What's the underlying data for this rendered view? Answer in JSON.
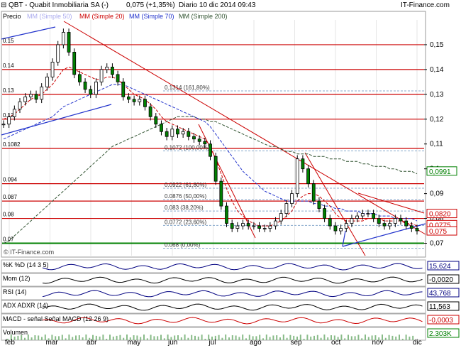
{
  "header": {
    "symbol_line": "QBT - Quabit Inmobiliaria SA (-)",
    "price_change": "0,075 (+1,35%)",
    "period_date": "Diario  10 dic 2014 09:43",
    "brand": "IT-Finance.com"
  },
  "legend": {
    "price": "Precio",
    "mm50": "MM (Simple 50)",
    "mm20": "MM (Simple 20)",
    "mm70": "MM (Simple 70)",
    "mm200": "MM (Simple 200)"
  },
  "watermark": "© IT-Finance.com",
  "colors": {
    "price": "#008000",
    "mm20": "#cc0000",
    "mm50": "#aaaaee",
    "mm70": "#2233cc",
    "mm200": "#335533",
    "resistance": "#cc0000",
    "support": "#008000",
    "trend_blue": "#2233cc",
    "fib": "#88aacc"
  },
  "chart_data": [
    {
      "type": "candlestick",
      "title": "",
      "months": [
        "feb",
        "mar",
        "abr",
        "may",
        "jun",
        "jul",
        "ago",
        "sep",
        "oct",
        "nov",
        "dic"
      ],
      "ylim": [
        0.065,
        0.16
      ],
      "y_ticks": [
        "0,15",
        "0,14",
        "0,13",
        "0,12",
        "0,11",
        "0,1",
        "0,09",
        "0,08",
        "0,07"
      ],
      "y_tick_values": [
        0.15,
        0.14,
        0.13,
        0.12,
        0.11,
        0.1,
        0.09,
        0.08,
        0.07
      ],
      "left_labels": [
        {
          "text": "0.15",
          "value": 0.15
        },
        {
          "text": "0.14",
          "value": 0.14
        },
        {
          "text": "0.13",
          "value": 0.13
        },
        {
          "text": "0.12",
          "value": 0.12
        },
        {
          "text": "0.1082",
          "value": 0.1082
        },
        {
          "text": "0.094",
          "value": 0.094
        },
        {
          "text": "0.087",
          "value": 0.087
        },
        {
          "text": "0.08",
          "value": 0.08
        },
        {
          "text": "0.07",
          "value": 0.07
        }
      ],
      "horizontal_levels": [
        0.15,
        0.14,
        0.13,
        0.12,
        0.1082,
        0.094,
        0.087,
        0.08
      ],
      "support_level": 0.07,
      "fib_levels": [
        {
          "label": "0.1314 (161,80%)",
          "value": 0.1314
        },
        {
          "label": "0.1072 (100,00%)",
          "value": 0.1072
        },
        {
          "label": "0.0922 (61,80%)",
          "value": 0.0922
        },
        {
          "label": "0.0876 (50,00%)",
          "value": 0.0876
        },
        {
          "label": "0.083 (38,20%)",
          "value": 0.083
        },
        {
          "label": "0.0772 (23,60%)",
          "value": 0.0772
        },
        {
          "label": "0.068 (0,00%)",
          "value": 0.068
        }
      ],
      "price_tags": [
        {
          "text": "0,0991",
          "value": 0.0991,
          "color": "#008000"
        },
        {
          "text": "0,0820",
          "value": 0.082,
          "color": "#cc0000"
        },
        {
          "text": "0,0775",
          "value": 0.0775,
          "color": "#cc0000"
        },
        {
          "text": "0,075",
          "value": 0.075,
          "color": "#cc0000"
        }
      ],
      "price_series": [
        0.118,
        0.121,
        0.124,
        0.127,
        0.129,
        0.13,
        0.128,
        0.133,
        0.137,
        0.143,
        0.15,
        0.155,
        0.147,
        0.138,
        0.135,
        0.132,
        0.13,
        0.135,
        0.14,
        0.141,
        0.138,
        0.135,
        0.129,
        0.128,
        0.127,
        0.128,
        0.125,
        0.121,
        0.118,
        0.115,
        0.113,
        0.116,
        0.114,
        0.115,
        0.113,
        0.112,
        0.111,
        0.11,
        0.105,
        0.095,
        0.085,
        0.078,
        0.076,
        0.077,
        0.078,
        0.077,
        0.077,
        0.076,
        0.076,
        0.077,
        0.079,
        0.082,
        0.086,
        0.09,
        0.104,
        0.1,
        0.094,
        0.087,
        0.084,
        0.08,
        0.077,
        0.075,
        0.076,
        0.078,
        0.08,
        0.081,
        0.082,
        0.082,
        0.08,
        0.078,
        0.077,
        0.078,
        0.08,
        0.079,
        0.077,
        0.076,
        0.075
      ],
      "mm20": [
        0.12,
        0.121,
        0.122,
        0.124,
        0.126,
        0.128,
        0.129,
        0.13,
        0.132,
        0.134,
        0.137,
        0.14,
        0.141,
        0.14,
        0.139,
        0.138,
        0.137,
        0.136,
        0.136,
        0.137,
        0.137,
        0.136,
        0.134,
        0.132,
        0.13,
        0.129,
        0.128,
        0.126,
        0.124,
        0.121,
        0.119,
        0.118,
        0.117,
        0.116,
        0.115,
        0.114,
        0.113,
        0.112,
        0.109,
        0.104,
        0.098,
        0.092,
        0.087,
        0.083,
        0.081,
        0.079,
        0.078,
        0.077,
        0.077,
        0.077,
        0.078,
        0.079,
        0.081,
        0.083,
        0.087,
        0.089,
        0.09,
        0.09,
        0.089,
        0.087,
        0.085,
        0.082,
        0.08,
        0.079,
        0.079,
        0.079,
        0.079,
        0.08,
        0.08,
        0.08,
        0.079,
        0.079,
        0.079,
        0.079,
        0.078,
        0.078,
        0.077
      ],
      "mm70": [
        0.112,
        0.113,
        0.114,
        0.115,
        0.116,
        0.117,
        0.118,
        0.119,
        0.12,
        0.121,
        0.123,
        0.125,
        0.126,
        0.127,
        0.128,
        0.129,
        0.13,
        0.131,
        0.132,
        0.133,
        0.134,
        0.134,
        0.134,
        0.133,
        0.132,
        0.131,
        0.13,
        0.129,
        0.128,
        0.127,
        0.126,
        0.125,
        0.124,
        0.123,
        0.122,
        0.121,
        0.12,
        0.119,
        0.117,
        0.114,
        0.111,
        0.108,
        0.105,
        0.102,
        0.099,
        0.097,
        0.095,
        0.093,
        0.091,
        0.09,
        0.089,
        0.088,
        0.087,
        0.087,
        0.087,
        0.087,
        0.087,
        0.086,
        0.086,
        0.085,
        0.085,
        0.084,
        0.084,
        0.083,
        0.083,
        0.083,
        0.082,
        0.082,
        0.082,
        0.081,
        0.081,
        0.081,
        0.08,
        0.08,
        0.08,
        0.08,
        0.079
      ],
      "mm200": [
        0.07,
        0.071,
        0.073,
        0.075,
        0.077,
        0.079,
        0.081,
        0.083,
        0.085,
        0.087,
        0.089,
        0.091,
        0.093,
        0.095,
        0.097,
        0.099,
        0.101,
        0.103,
        0.105,
        0.107,
        0.109,
        0.11,
        0.111,
        0.112,
        0.113,
        0.114,
        0.115,
        0.116,
        0.117,
        0.118,
        0.119,
        0.12,
        0.121,
        0.121,
        0.121,
        0.121,
        0.12,
        0.12,
        0.119,
        0.119,
        0.118,
        0.117,
        0.116,
        0.115,
        0.114,
        0.113,
        0.112,
        0.111,
        0.11,
        0.109,
        0.109,
        0.108,
        0.107,
        0.107,
        0.106,
        0.106,
        0.106,
        0.105,
        0.105,
        0.105,
        0.104,
        0.104,
        0.104,
        0.103,
        0.103,
        0.103,
        0.102,
        0.102,
        0.101,
        0.101,
        0.101,
        0.1,
        0.1,
        0.099,
        0.099,
        0.099,
        0.098
      ]
    }
  ],
  "indicators": [
    {
      "name": "%K",
      "label": "%K  %D (14 3 5)",
      "value": "15,624",
      "color": "#000080"
    },
    {
      "name": "Mom",
      "label": "Mom (12)",
      "value": "-0,0020",
      "color": "#000000"
    },
    {
      "name": "RSI",
      "label": "RSI (14)",
      "value": "43,768",
      "color": "#000080"
    },
    {
      "name": "ADX",
      "label": "ADX  ADXR (14)",
      "value": "11,563",
      "color": "#000000"
    },
    {
      "name": "MACD",
      "label": "MACD - señal  Señal  MACD (12 26 9)",
      "value": "-0,0003",
      "color": "#cc0000"
    },
    {
      "name": "Volumen",
      "label": "Volumen",
      "value": "2.303K",
      "color": "#008000"
    }
  ]
}
